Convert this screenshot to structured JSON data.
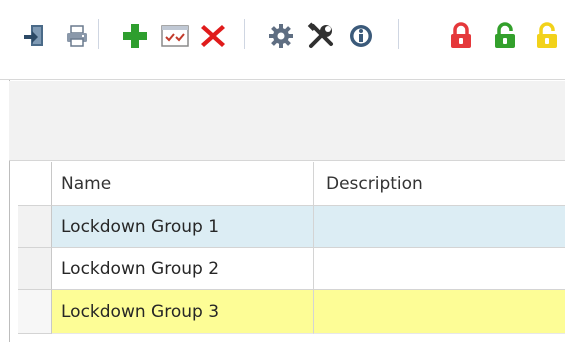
{
  "toolbar": {
    "buttons": [
      {
        "icon": "export-icon",
        "color": "#4a6a88"
      },
      {
        "icon": "print-icon",
        "color": "#6a7a8e"
      },
      {
        "icon": "add-icon",
        "color": "#2e9e2e"
      },
      {
        "icon": "checklist-icon",
        "color": "#c23b2b"
      },
      {
        "icon": "delete-icon",
        "color": "#e01b1b"
      },
      {
        "icon": "gear-icon",
        "color": "#5f6e82"
      },
      {
        "icon": "tools-icon",
        "color": "#303030"
      },
      {
        "icon": "info-icon",
        "color": "#3b5a7a"
      },
      {
        "icon": "lock-closed-icon",
        "color": "#e5383b"
      },
      {
        "icon": "lock-open-icon",
        "color": "#33a02c"
      },
      {
        "icon": "lock-partial-icon",
        "color": "#f2d21a"
      }
    ]
  },
  "grid": {
    "columns": [
      "Name",
      "Description"
    ],
    "rows": [
      {
        "name": "Lockdown Group 1",
        "description": "",
        "state": "selected",
        "color": "#dcedf4"
      },
      {
        "name": "Lockdown Group 2",
        "description": "",
        "state": "normal",
        "color": "#ffffff"
      },
      {
        "name": "Lockdown Group 3",
        "description": "",
        "state": "highlighted",
        "color": "#fdfd96"
      }
    ]
  }
}
